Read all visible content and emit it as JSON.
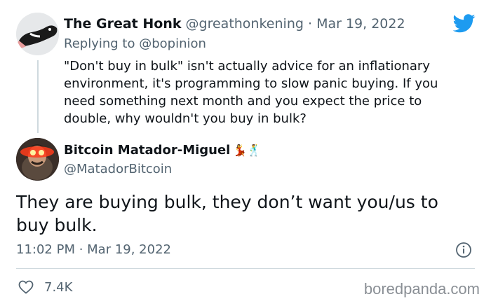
{
  "parent_tweet": {
    "display_name": "The Great Honk",
    "handle": "@greathonkening",
    "separator": "·",
    "date": "Mar 19, 2022",
    "replying_to_label": "Replying to",
    "replying_to_handle": "@bopinion",
    "text": "\"Don't buy in bulk\" isn't actually advice for an inflationary environment, it's programming to slow panic buying. If you need something next month and you expect the price to double, why wouldn't you buy in bulk?",
    "avatar_icon": "goose-avatar"
  },
  "reply_tweet": {
    "display_name": "Bitcoin Matador-Miguel",
    "emoji": "💃🕺",
    "handle": "@MatadorBitcoin",
    "text": "They are buying bulk, they don’t want you/us to buy bulk.",
    "timestamp": "11:02 PM · Mar 19, 2022",
    "likes": "7.4K",
    "avatar_icon": "laser-eyes-avatar"
  },
  "icons": {
    "brand": "twitter-bird-icon",
    "info": "info-icon",
    "like": "heart-icon"
  },
  "colors": {
    "twitter_blue": "#1d9bf0",
    "text": "#0f1419",
    "muted": "#536471",
    "divider": "#cfd9de"
  },
  "watermark": "boredpanda.com"
}
